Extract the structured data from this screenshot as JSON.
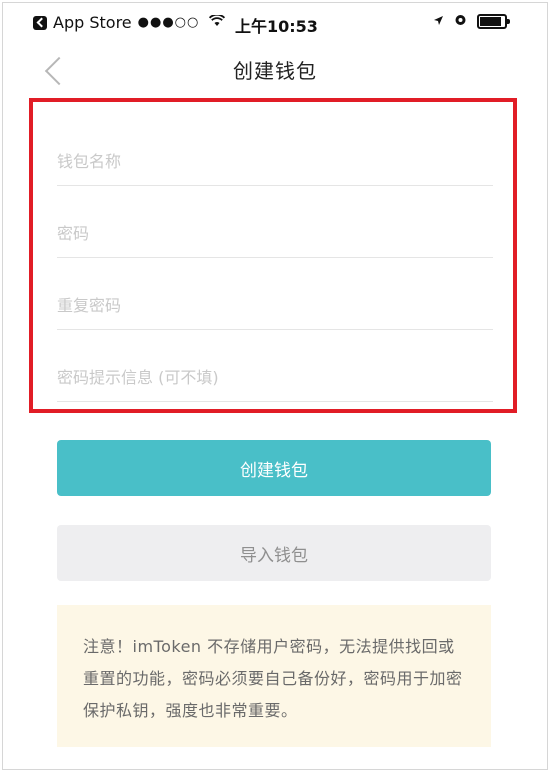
{
  "status_bar": {
    "carrier": "App Store",
    "signal": "●●●○○",
    "time": "上午10:53"
  },
  "nav": {
    "title": "创建钱包"
  },
  "form": {
    "wallet_name_placeholder": "钱包名称",
    "password_placeholder": "密码",
    "repeat_password_placeholder": "重复密码",
    "password_hint_placeholder": "密码提示信息 (可不填)"
  },
  "buttons": {
    "create_label": "创建钱包",
    "import_label": "导入钱包"
  },
  "notice": {
    "text": "注意！imToken 不存储用户密码，无法提供找回或重置的功能，密码必须要自己备份好，密码用于加密保护私钥，强度也非常重要。"
  },
  "colors": {
    "accent": "#49bfc8",
    "highlight_border": "#e11d26",
    "notice_bg": "#fdf7e6",
    "secondary_button_bg": "#eeeef0"
  },
  "icons": {
    "back": "chevron-left-icon",
    "app_back": "app-store-back-icon",
    "wifi": "wifi-icon",
    "location": "location-arrow-icon",
    "alarm": "alarm-icon",
    "battery": "battery-icon"
  }
}
